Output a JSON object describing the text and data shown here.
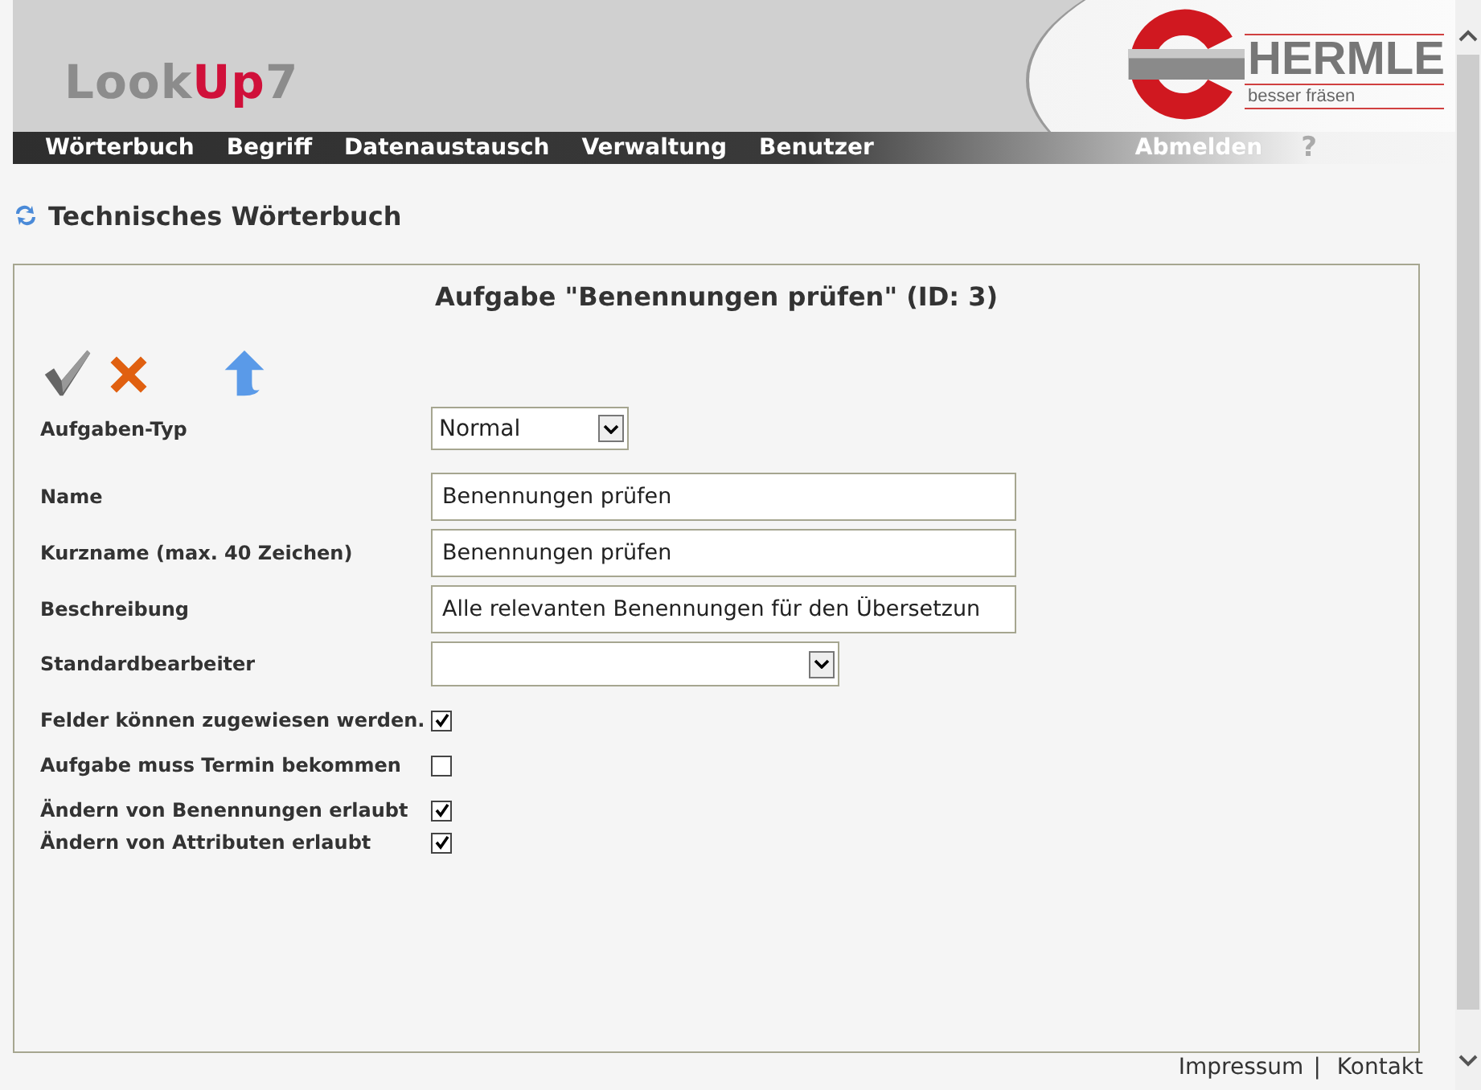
{
  "header": {
    "logo": [
      {
        "text": "Look",
        "kind": "plain"
      },
      {
        "text": "Up",
        "kind": "accent"
      },
      {
        "text": "7",
        "kind": "plain"
      }
    ],
    "brand": {
      "name": "HERMLE",
      "slogan": "besser fräsen"
    },
    "nav": [
      {
        "label": "Wörterbuch"
      },
      {
        "label": "Begriff"
      },
      {
        "label": "Datenaustausch"
      },
      {
        "label": "Verwaltung"
      },
      {
        "label": "Benutzer"
      }
    ],
    "logout": "Abmelden",
    "help": "?"
  },
  "page_title": "Technisches Wörterbuch",
  "form": {
    "title": "Aufgabe \"Benennungen prüfen\" (ID: 3)",
    "sections": [
      [
        {
          "kind": "select",
          "label": "Aufgaben-Typ",
          "value": "Normal"
        }
      ],
      [
        {
          "kind": "text",
          "label": "Name",
          "value": "Benennungen prüfen"
        },
        {
          "kind": "text",
          "label": "Kurzname (max. 40 Zeichen)",
          "value": "Benennungen prüfen"
        },
        {
          "kind": "text",
          "label": "Beschreibung",
          "value": "Alle relevanten Benennungen für den Übersetzun"
        },
        {
          "kind": "select",
          "label": "Standardbearbeiter"
        }
      ],
      [
        {
          "kind": "checkbox",
          "label": "Felder können zugewiesen werden.",
          "checked": true
        }
      ],
      [
        {
          "kind": "checkbox",
          "label": "Aufgabe muss Termin bekommen",
          "checked": false
        }
      ],
      [
        {
          "kind": "checkbox",
          "label": "Ändern von Benennungen erlaubt",
          "checked": true
        },
        {
          "kind": "checkbox",
          "label": "Ändern von Attributen erlaubt",
          "checked": true
        }
      ]
    ]
  },
  "footer": {
    "links": [
      "Impressum",
      "Kontakt"
    ],
    "separator": "|"
  }
}
